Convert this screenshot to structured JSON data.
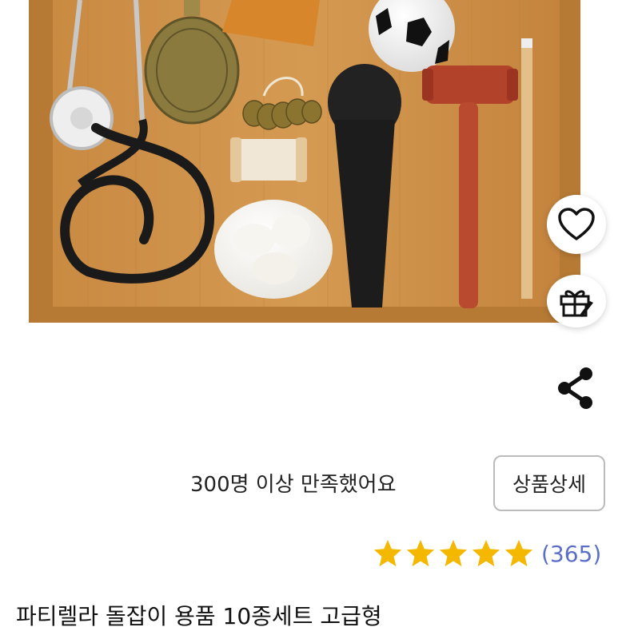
{
  "product": {
    "title": "파티렐라 돌잡이 용품 10종세트 고급형",
    "satisfaction_text": "300명 이상 만족했어요",
    "detail_button_label": "상품상세",
    "rating": 5,
    "review_count": "(365)"
  },
  "actions": {
    "wishlist_icon": "heart-icon",
    "gift_icon": "gift-icon",
    "share_icon": "share-icon"
  },
  "colors": {
    "star": "#F5B800",
    "review_count": "#5A6FC7",
    "tray": "#C8893E"
  }
}
